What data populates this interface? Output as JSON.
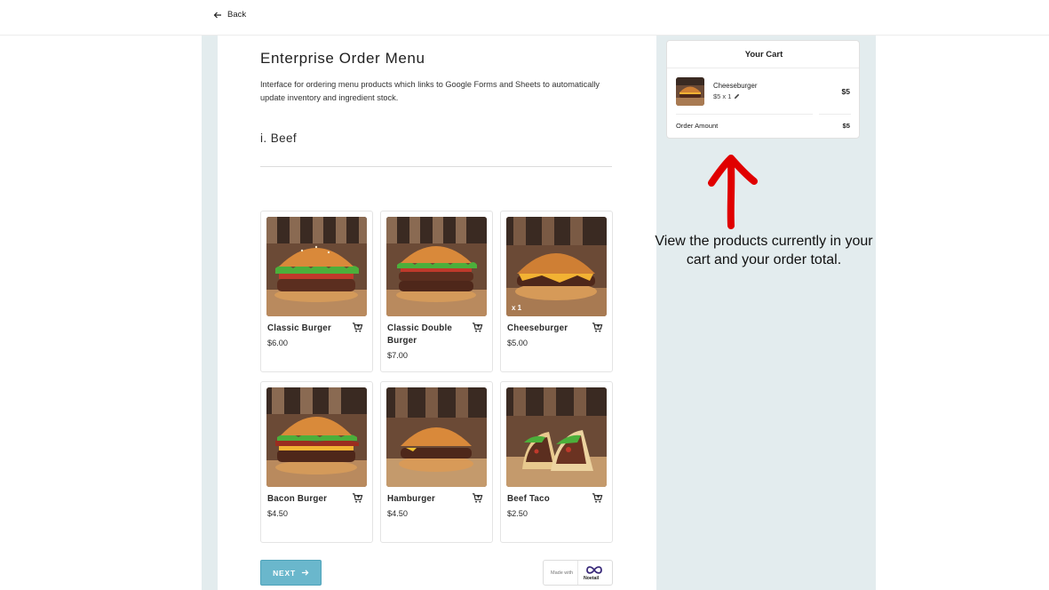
{
  "nav": {
    "back_label": "Back"
  },
  "header": {
    "title": "Enterprise Order Menu",
    "description": "Interface for ordering menu products which links to Google Forms and Sheets to automatically update inventory and ingredient stock."
  },
  "section": {
    "title": "i. Beef"
  },
  "products": [
    {
      "name": "Classic Burger",
      "price": "$6.00",
      "qty_badge": "",
      "image": "classic-burger"
    },
    {
      "name": "Classic Double Burger",
      "price": "$7.00",
      "qty_badge": "",
      "image": "double-burger"
    },
    {
      "name": "Cheeseburger",
      "price": "$5.00",
      "qty_badge": "x 1",
      "image": "cheeseburger"
    },
    {
      "name": "Bacon Burger",
      "price": "$4.50",
      "qty_badge": "",
      "image": "bacon-burger"
    },
    {
      "name": "Hamburger",
      "price": "$4.50",
      "qty_badge": "",
      "image": "hamburger"
    },
    {
      "name": "Beef Taco",
      "price": "$2.50",
      "qty_badge": "",
      "image": "beef-taco"
    }
  ],
  "footer": {
    "next_label": "NEXT",
    "made_with": "Made with",
    "brand": "Noetail"
  },
  "cart": {
    "title": "Your Cart",
    "items": [
      {
        "name": "Cheeseburger",
        "qty_text": "$5 x 1",
        "price": "$5"
      }
    ],
    "order_amount_label": "Order Amount",
    "order_amount_value": "$5"
  },
  "annotation": {
    "text": "View the products currently in your cart and your order total."
  },
  "colors": {
    "accent": "#6ab7cc",
    "sidebar_bg": "#e3ecee",
    "annotation_arrow": "#e00000"
  }
}
